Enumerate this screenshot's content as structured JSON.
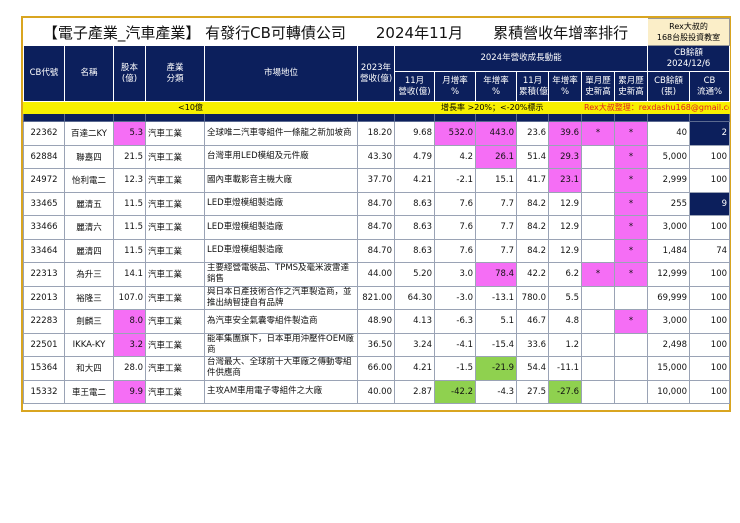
{
  "title": "【電子產業_汽車產業】 有發行CB可轉債公司　　2024年11月　　累積營收年增率排行",
  "rex_badge": [
    "Rex大叔的",
    "168台股投資教室"
  ],
  "headers": {
    "code": "CB代號",
    "name": "名稱",
    "capital": "股本\n(億)",
    "industry": "產業\n分類",
    "market": "市場地位",
    "rev2023": "2023年\n營收(億)",
    "group2024": "2024年營收成長動能",
    "cb_group": "CB餘額\n2024/12/6",
    "nov_rev": "11月\n營收(億)",
    "mom": "月增率\n%",
    "yoy": "年增率\n%",
    "nov_cum": "11月\n累積(億)",
    "cum_yoy": "年增率\n%",
    "month_high": "單月歷\n史新高",
    "cum_high": "累月歷\n史新高",
    "cb_bal": "CB餘額\n(張)",
    "cb_pct": "CB\n流通%"
  },
  "notes": {
    "small_cap": "<10億",
    "growth_rule": "增長率 >20%；<-20%標示",
    "author": "Rex大叔整理：rexdashu168@gmail.com"
  },
  "colors": {
    "navy": "#0c1f5c",
    "pink": "#f56ef5",
    "green": "#8fd14f",
    "yellow": "#f7f000",
    "gold": "#d9a520"
  },
  "rows": [
    [
      "22362",
      "百達二KY",
      "5.3",
      "汽車工業",
      "全球唯二汽車零組件一條龍之新加坡商",
      "18.20",
      "9.68",
      "532.0",
      "443.0",
      "23.6",
      "39.6",
      "*",
      "*",
      "40",
      "2"
    ],
    [
      "62884",
      "聯嘉四",
      "21.5",
      "汽車工業",
      "台灣車用LED模組及元件廠",
      "43.30",
      "4.79",
      "4.2",
      "26.1",
      "51.4",
      "29.3",
      "",
      "*",
      "5,000",
      "100"
    ],
    [
      "24972",
      "怡利電二",
      "12.3",
      "汽車工業",
      "國內車載影音主機大廠",
      "37.70",
      "4.21",
      "-2.1",
      "15.1",
      "41.7",
      "23.1",
      "",
      "*",
      "2,999",
      "100"
    ],
    [
      "33465",
      "麗清五",
      "11.5",
      "汽車工業",
      "LED車燈模組製造廠",
      "84.70",
      "8.63",
      "7.6",
      "7.7",
      "84.2",
      "12.9",
      "",
      "*",
      "255",
      "9"
    ],
    [
      "33466",
      "麗清六",
      "11.5",
      "汽車工業",
      "LED車燈模組製造廠",
      "84.70",
      "8.63",
      "7.6",
      "7.7",
      "84.2",
      "12.9",
      "",
      "*",
      "3,000",
      "100"
    ],
    [
      "33464",
      "麗清四",
      "11.5",
      "汽車工業",
      "LED車燈模組製造廠",
      "84.70",
      "8.63",
      "7.6",
      "7.7",
      "84.2",
      "12.9",
      "",
      "*",
      "1,484",
      "74"
    ],
    [
      "22313",
      "為升三",
      "14.1",
      "汽車工業",
      "主要經營電裝品、TPMS及毫米波雷達銷售",
      "44.00",
      "5.20",
      "3.0",
      "78.4",
      "42.2",
      "6.2",
      "*",
      "*",
      "12,999",
      "100"
    ],
    [
      "22013",
      "裕隆三",
      "107.0",
      "汽車工業",
      "與日本日產技術合作之汽車製造商，並推出納智捷自有品牌",
      "821.00",
      "64.30",
      "-3.0",
      "-13.1",
      "780.0",
      "5.5",
      "",
      "",
      "69,999",
      "100"
    ],
    [
      "22283",
      "劍麟三",
      "8.0",
      "汽車工業",
      "為汽車安全氣囊零組件製造商",
      "48.90",
      "4.13",
      "-6.3",
      "5.1",
      "46.7",
      "4.8",
      "",
      "*",
      "3,000",
      "100"
    ],
    [
      "22501",
      "IKKA-KY",
      "3.2",
      "汽車工業",
      "能率集團旗下，日本車用沖壓件OEM廠商",
      "36.50",
      "3.24",
      "-4.1",
      "-15.4",
      "33.6",
      "1.2",
      "",
      "",
      "2,498",
      "100"
    ],
    [
      "15364",
      "和大四",
      "28.0",
      "汽車工業",
      "台灣最大、全球前十大車廠之傳動零組件供應商",
      "66.00",
      "4.21",
      "-1.5",
      "-21.9",
      "54.4",
      "-11.1",
      "",
      "",
      "15,000",
      "100"
    ],
    [
      "15332",
      "車王電二",
      "9.9",
      "汽車工業",
      "主攻AM車用電子零組件之大廠",
      "40.00",
      "2.87",
      "-42.2",
      "-4.3",
      "27.5",
      "-27.6",
      "",
      "",
      "10,000",
      "100"
    ]
  ]
}
